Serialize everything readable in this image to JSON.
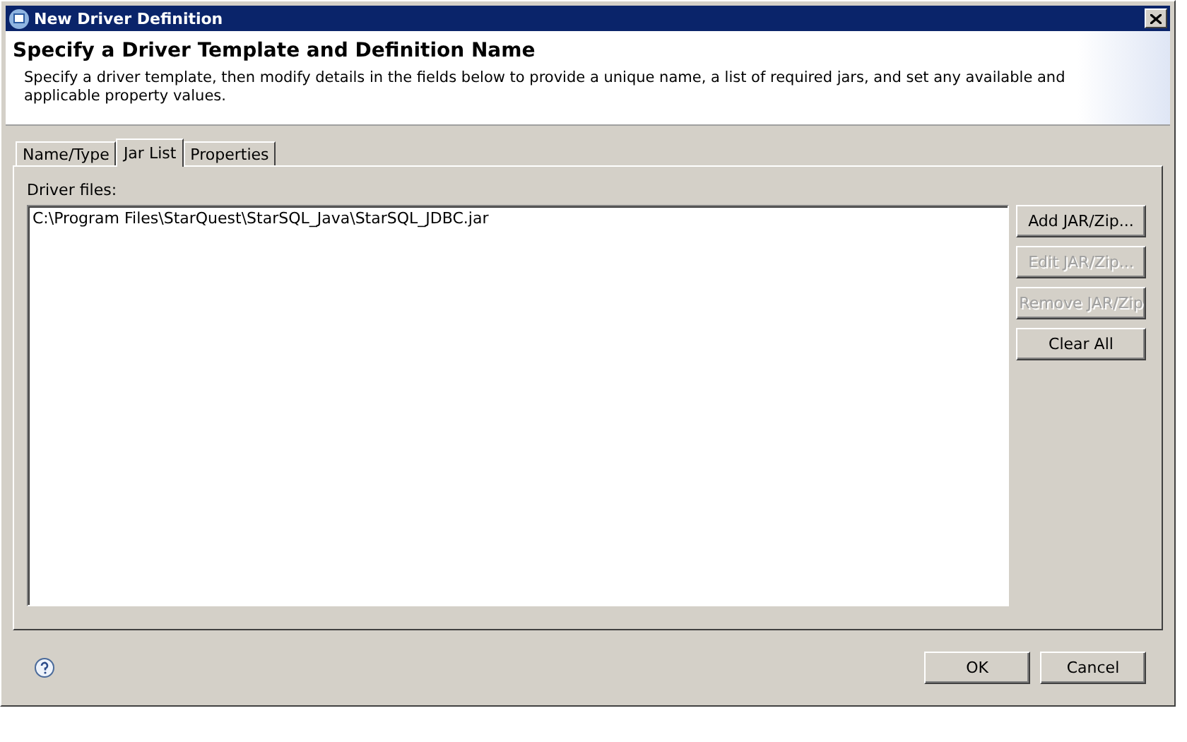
{
  "window": {
    "title": "New Driver Definition"
  },
  "header": {
    "title": "Specify a Driver Template and Definition Name",
    "description": "Specify a driver template, then modify details in the fields below to provide a unique name, a list of required jars, and set any available and applicable property values."
  },
  "tabs": [
    {
      "label": "Name/Type",
      "selected": false
    },
    {
      "label": "Jar List",
      "selected": true
    },
    {
      "label": "Properties",
      "selected": false
    }
  ],
  "driver_files": {
    "label": "Driver files:",
    "items": [
      {
        "text": "C:\\Program Files\\StarQuest\\StarSQL_Java\\StarSQL_JDBC.jar",
        "selected": false
      }
    ]
  },
  "side_buttons": [
    {
      "label": "Add JAR/Zip...",
      "disabled": false
    },
    {
      "label": "Edit JAR/Zip...",
      "disabled": true
    },
    {
      "label": "Remove JAR/Zip",
      "disabled": true
    },
    {
      "label": "Clear All",
      "disabled": false
    }
  ],
  "buttons": [
    "OK",
    "Cancel"
  ]
}
